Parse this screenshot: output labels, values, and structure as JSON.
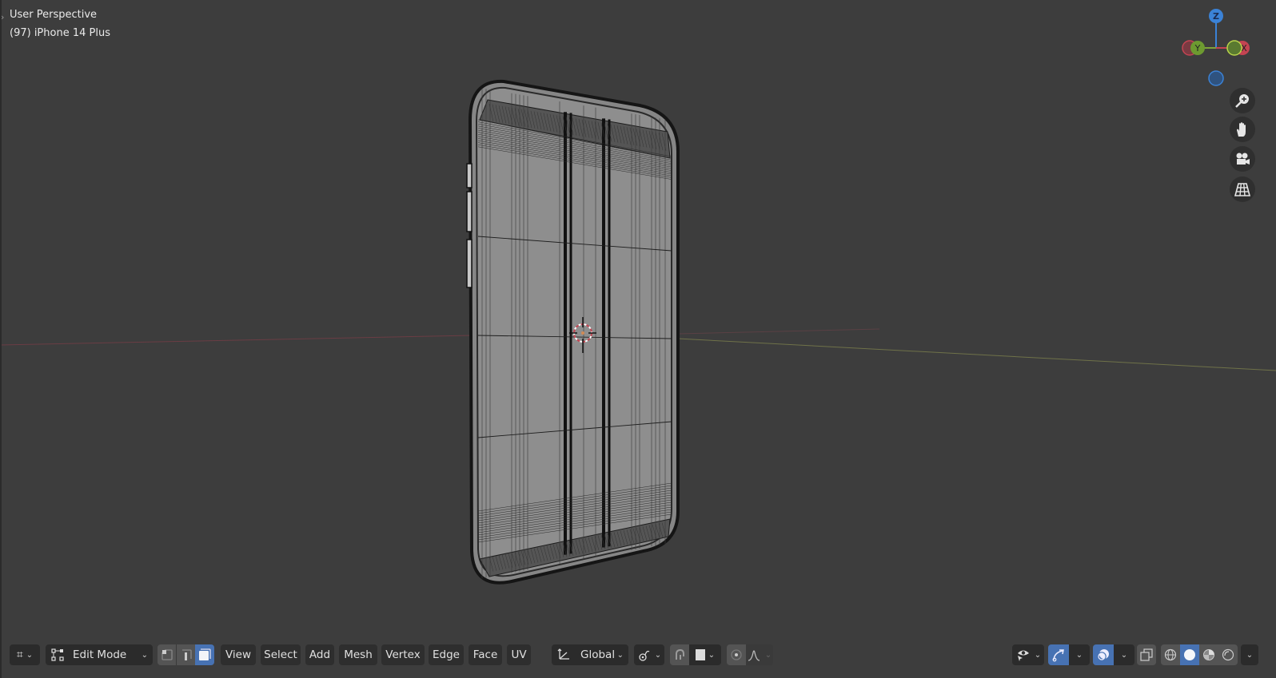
{
  "viewport": {
    "view_name": "User Perspective",
    "object_label": "(97) iPhone 14 Plus",
    "background_color": "#3d3d3d",
    "axis_colors": {
      "x": "#c44452",
      "y": "#7fa33a",
      "z": "#3b82d6"
    }
  },
  "gizmo": {
    "z_label": "Z",
    "y_label": "Y",
    "x_label": "X"
  },
  "nav_buttons": [
    {
      "name": "zoom",
      "icon": "zoom-in-icon"
    },
    {
      "name": "pan",
      "icon": "hand-icon"
    },
    {
      "name": "camera",
      "icon": "camera-icon"
    },
    {
      "name": "perspective",
      "icon": "grid-icon"
    }
  ],
  "header": {
    "editor_type_icon": "viewport-icon",
    "mode": "Edit Mode",
    "select_modes": [
      "vertex",
      "edge",
      "face"
    ],
    "active_select_mode": "face",
    "menus": [
      "View",
      "Select",
      "Add",
      "Mesh",
      "Vertex",
      "Edge",
      "Face",
      "UV"
    ],
    "transform_orientation": "Global",
    "pivot_icon": "pivot-icon",
    "snap_icon": "magnet-icon",
    "proportional_icon": "proportional-icon",
    "falloff_icon": "falloff-curve-icon",
    "visibility_icon": "eye-icon",
    "gizmo_icon": "gizmo-arrow-icon",
    "overlay_icon": "overlay-icon",
    "xray_icon": "xray-icon",
    "shading_modes": [
      "wireframe",
      "solid",
      "material",
      "rendered"
    ],
    "active_shading": "solid"
  }
}
